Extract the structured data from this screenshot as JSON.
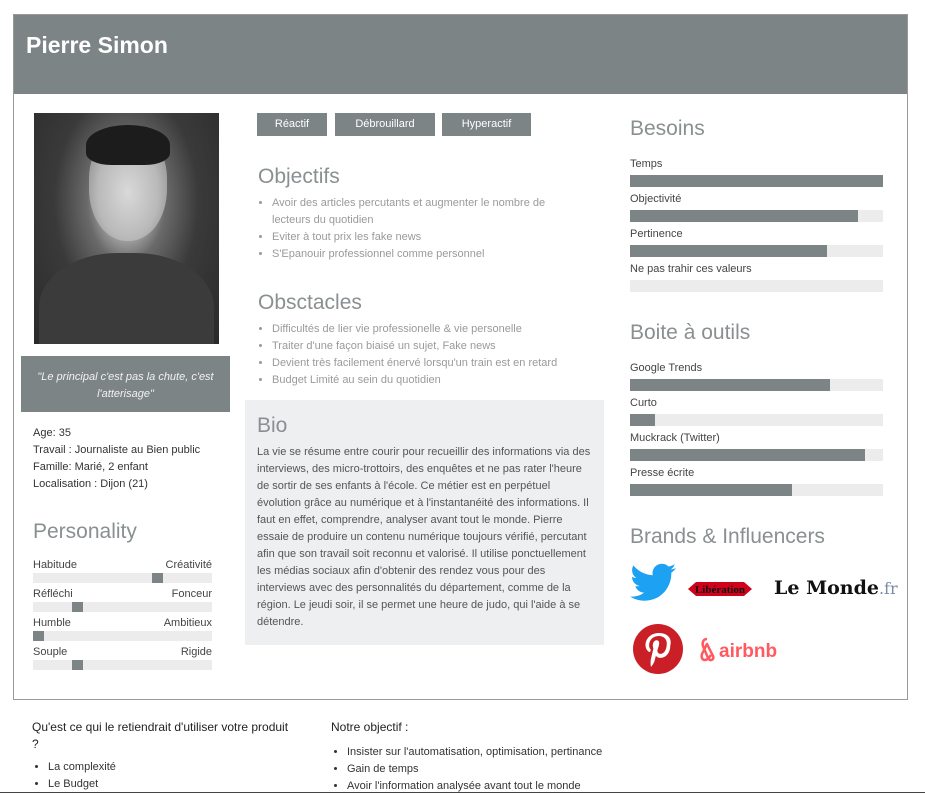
{
  "persona": {
    "name": "Pierre Simon",
    "quote": "\"Le principal c'est pas la chute, c'est l'atterisage\"",
    "facts": [
      {
        "label": "Age:",
        "value": "35"
      },
      {
        "label": "Travail :",
        "value": "Journaliste au Bien public"
      },
      {
        "label": "Famille:",
        "value": "Marié, 2 enfant"
      },
      {
        "label": "Localisation :",
        "value": "Dijon (21)"
      }
    ]
  },
  "tags": [
    "Réactif",
    "Débrouillard",
    "Hyperactif"
  ],
  "personality": {
    "title": "Personality",
    "rows": [
      {
        "left": "Habitude",
        "right": "Créativité",
        "level": 0.71
      },
      {
        "left": "Réfléchi",
        "right": "Fonceur",
        "level": 0.23
      },
      {
        "left": "Humble",
        "right": "Ambitieux",
        "level": 0.0
      },
      {
        "left": "Souple",
        "right": "Rigide",
        "level": 0.23
      }
    ]
  },
  "objectifs": {
    "title": "Objectifs",
    "items": [
      "Avoir des articles percutants et augmenter le nombre de lecteurs du quotidien",
      "Eviter à tout prix les fake news",
      "S'Epanouir professionnel comme personnel"
    ]
  },
  "obstacles": {
    "title": "Obsctacles",
    "items": [
      "Difficultés de lier vie professionelle & vie personelle",
      "Traiter d'une façon biaisé un sujet, Fake news",
      "Devient très facilement énervé lorsqu'un train est en retard",
      "Budget Limité au sein du quotidien"
    ]
  },
  "bio": {
    "title": "Bio",
    "text": "La vie se résume entre courir pour recueillir des informations via des interviews, des micro-trottoirs, des enquêtes et ne pas rater l'heure de sortir de ses enfants à l'école. Ce métier est en perpétuel évolution grâce au numérique et à l'instantanéité des informations. Il faut en effet, comprendre, analyser avant tout le monde. Pierre essaie de produire un contenu numérique toujours vérifié, percutant afin que son travail soit reconnu et valorisé. Il utilise ponctuellement les médias sociaux afin d'obtenir des rendez vous pour des interviews avec des personnalités du département, comme de la région. Le jeudi soir, il se permet une heure de judo, qui l'aide à se détendre."
  },
  "besoins": {
    "title": "Besoins",
    "items": [
      {
        "label": "Temps",
        "level": 1.0
      },
      {
        "label": "Objectivité",
        "level": 0.9
      },
      {
        "label": "Pertinence",
        "level": 0.78
      },
      {
        "label": "Ne pas trahir ces valeurs",
        "level": 0.0
      }
    ]
  },
  "outils": {
    "title": "Boite à outils",
    "items": [
      {
        "label": "Google Trends",
        "level": 0.79
      },
      {
        "label": "Curto",
        "level": 0.1
      },
      {
        "label": "Muckrack (Twitter)",
        "level": 0.93
      },
      {
        "label": "Presse écrite",
        "level": 0.64
      }
    ]
  },
  "brands": {
    "title": "Brands & Influencers",
    "logos": [
      {
        "name": "twitter",
        "icon": "twitter-logo",
        "color": "#1da1f2"
      },
      {
        "name": "liberation",
        "text": "Libération",
        "color": "#d0021b"
      },
      {
        "name": "lemonde",
        "text": "Le Monde",
        "suffix": ".fr"
      },
      {
        "name": "pinterest",
        "icon": "pinterest-logo",
        "color": "#cb1f27"
      },
      {
        "name": "airbnb",
        "text": "airbnb",
        "color": "#ff5a5f"
      }
    ]
  },
  "bottom": {
    "left_question": "Qu'est ce qui le retiendrait d'utiliser votre produit ?",
    "left_items": [
      "La complexité",
      "Le Budget"
    ],
    "right_title": "Notre objectif :",
    "right_items": [
      "Insister sur l'automatisation, optimisation, pertinance",
      "Gain de temps",
      "Avoir l'information analysée avant tout le monde"
    ]
  },
  "colors": {
    "header": "#7d8486",
    "bar_fill": "#7d8486",
    "bar_track": "#ececec",
    "bio_bg": "#eeeff0"
  }
}
